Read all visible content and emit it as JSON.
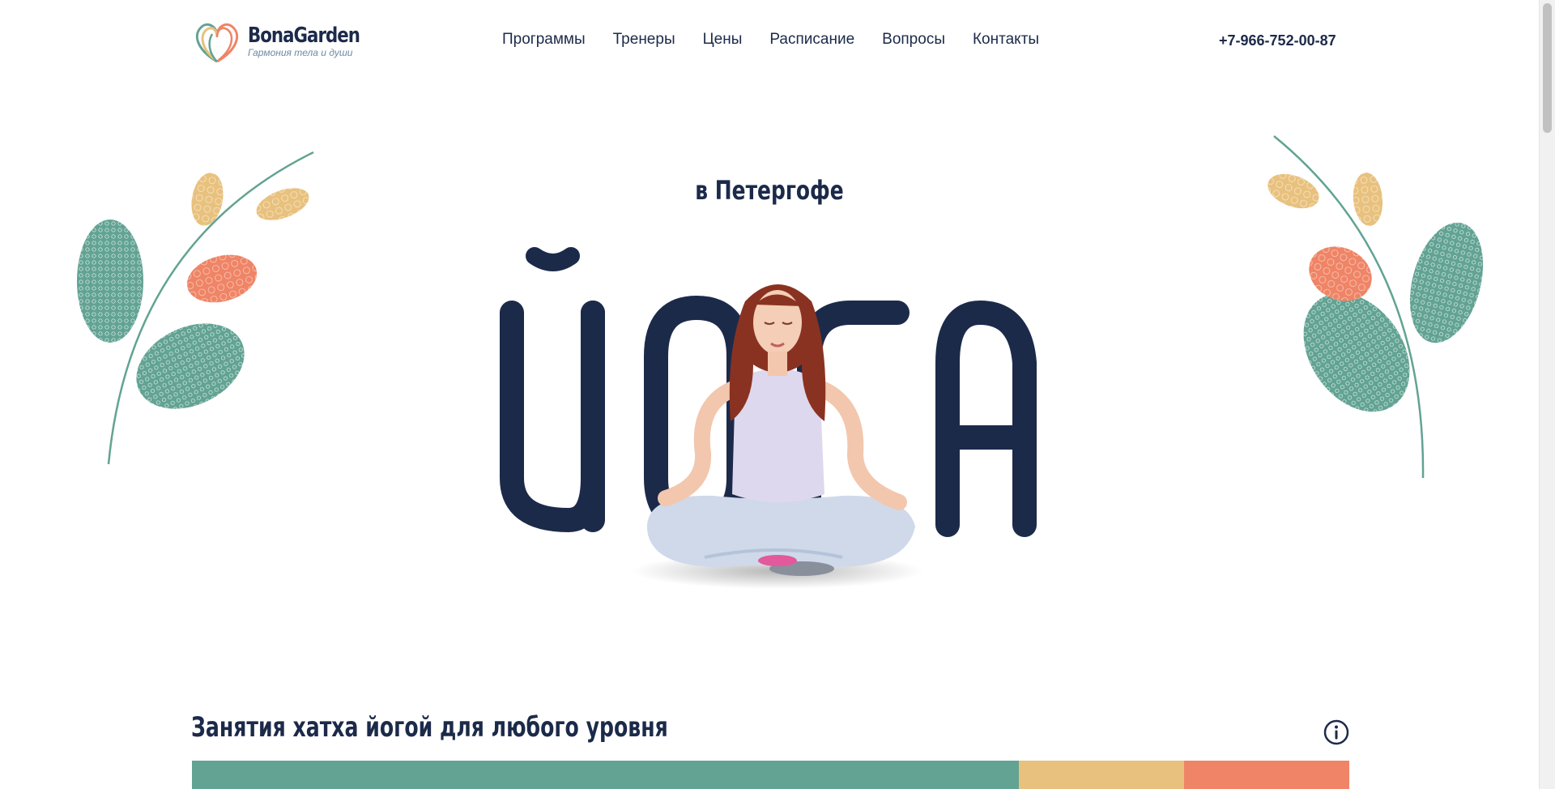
{
  "brand": {
    "name": "BonaGarden",
    "tagline": "Гармония тела и души"
  },
  "nav": {
    "items": [
      "Программы",
      "Тренеры",
      "Цены",
      "Расписание",
      "Вопросы",
      "Контакты"
    ],
    "phone": "+7-966-752-00-87"
  },
  "hero": {
    "subtitle": "в Петергофе",
    "headline": "ЙОГА"
  },
  "section": {
    "title": "Занятия хатха йогой для любого уровня"
  },
  "colors": {
    "navy": "#1c2a4a",
    "green": "#62a393",
    "yellow": "#e8c17e",
    "orange": "#ef8466"
  }
}
